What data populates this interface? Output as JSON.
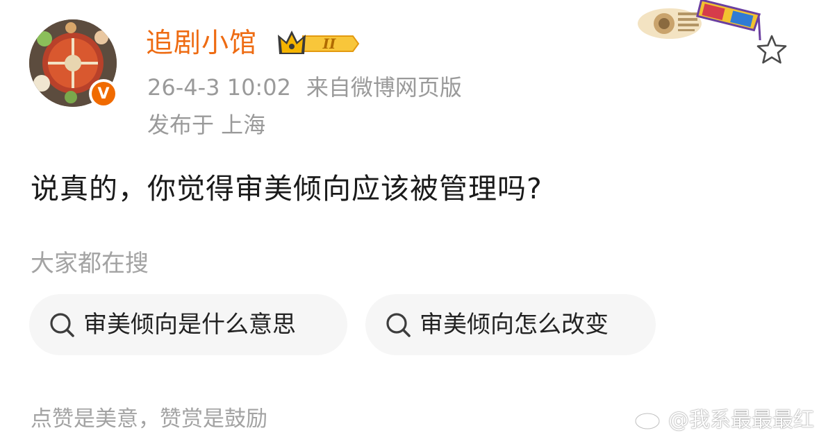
{
  "colors": {
    "username": "#ee6b12",
    "verified": "#f06a00",
    "badge": "#f5b400",
    "meta": "#9a9a9a",
    "chip_bg": "#f6f6f6"
  },
  "post": {
    "author": {
      "name": "追剧小馆",
      "level": "II",
      "verified_mark": "V"
    },
    "time": "26-4-3 10:02",
    "source": "来自微博网页版",
    "location": "发布于 上海",
    "text": "说真的，你觉得审美倾向应该被管理吗?"
  },
  "search": {
    "heading": "大家都在搜",
    "items": [
      {
        "label": "审美倾向是什么意思",
        "icon": "search-icon"
      },
      {
        "label": "审美倾向怎么改变",
        "icon": "search-icon"
      }
    ]
  },
  "footer": {
    "reward_text": "点赞是美意，赞赏是鼓励"
  },
  "watermark": {
    "text": "@我系最最最红",
    "icon": "weibo-icon"
  },
  "actions": {
    "favorite_icon": "star-icon"
  }
}
